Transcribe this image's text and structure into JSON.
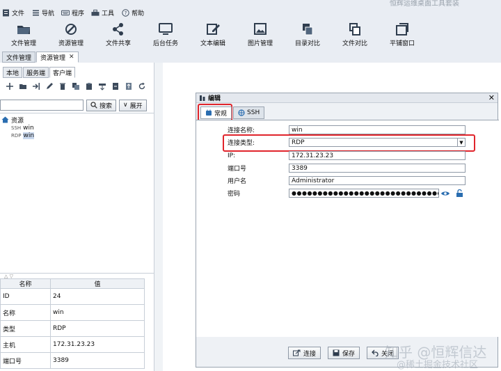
{
  "window": {
    "title": "恒辉运维桌面工具套装"
  },
  "menu": [
    {
      "label": "文件",
      "icon": "file-icon"
    },
    {
      "label": "导航",
      "icon": "menu-icon"
    },
    {
      "label": "程序",
      "icon": "keyboard-icon"
    },
    {
      "label": "工具",
      "icon": "tools-icon"
    },
    {
      "label": "帮助",
      "icon": "help-icon"
    }
  ],
  "toolbar": [
    {
      "label": "文件管理",
      "icon": "folder-icon"
    },
    {
      "label": "资源管理",
      "icon": "network-icon"
    },
    {
      "label": "文件共享",
      "icon": "share-icon"
    },
    {
      "label": "后台任务",
      "icon": "monitor-icon"
    },
    {
      "label": "文本编辑",
      "icon": "edit-icon"
    },
    {
      "label": "图片管理",
      "icon": "image-icon"
    },
    {
      "label": "目录对比",
      "icon": "compare-dir-icon"
    },
    {
      "label": "文件对比",
      "icon": "compare-file-icon"
    },
    {
      "label": "平铺窗口",
      "icon": "tile-window-icon"
    }
  ],
  "panel_tabs": [
    {
      "label": "文件管理"
    },
    {
      "label": "资源管理",
      "close": "✕"
    }
  ],
  "sub_tabs": [
    "本地",
    "服务端",
    "客户端"
  ],
  "search": {
    "button": "搜索",
    "expand": "展开"
  },
  "tree": {
    "root": "资源",
    "nodes": [
      {
        "tag": "SSH",
        "name": "win"
      },
      {
        "tag": "RDP",
        "name": "win"
      }
    ]
  },
  "split": {
    "marks": "△ ▽"
  },
  "properties": {
    "headers": [
      "名称",
      "值"
    ],
    "rows": [
      [
        "ID",
        "24"
      ],
      [
        "名称",
        "win"
      ],
      [
        "类型",
        "RDP"
      ],
      [
        "主机",
        "172.31.23.23"
      ],
      [
        "端口号",
        "3389"
      ]
    ]
  },
  "dialog": {
    "title": "编辑",
    "close": "✕",
    "tabs": [
      "常规",
      "SSH"
    ],
    "fields": [
      {
        "label": "连接名称:",
        "value": "win"
      },
      {
        "label": "连接类型:",
        "value": "RDP"
      },
      {
        "label": "IP:",
        "value": "172.31.23.23"
      },
      {
        "label": "端口号",
        "value": "3389"
      },
      {
        "label": "用户名",
        "value": "Administrator"
      },
      {
        "label": "密码",
        "value": "●●●●●●●●●●●●●●●●●●●●●●●●●●●●●●●●●●●●●●●●●●"
      }
    ],
    "buttons": [
      "连接",
      "保存",
      "关闭"
    ]
  },
  "watermark": {
    "line1": "知乎 @恒辉信达",
    "line2": "@稀土掘金技术社区"
  },
  "colors": {
    "highlight": "#e0242b",
    "accent": "#2a6db0"
  }
}
